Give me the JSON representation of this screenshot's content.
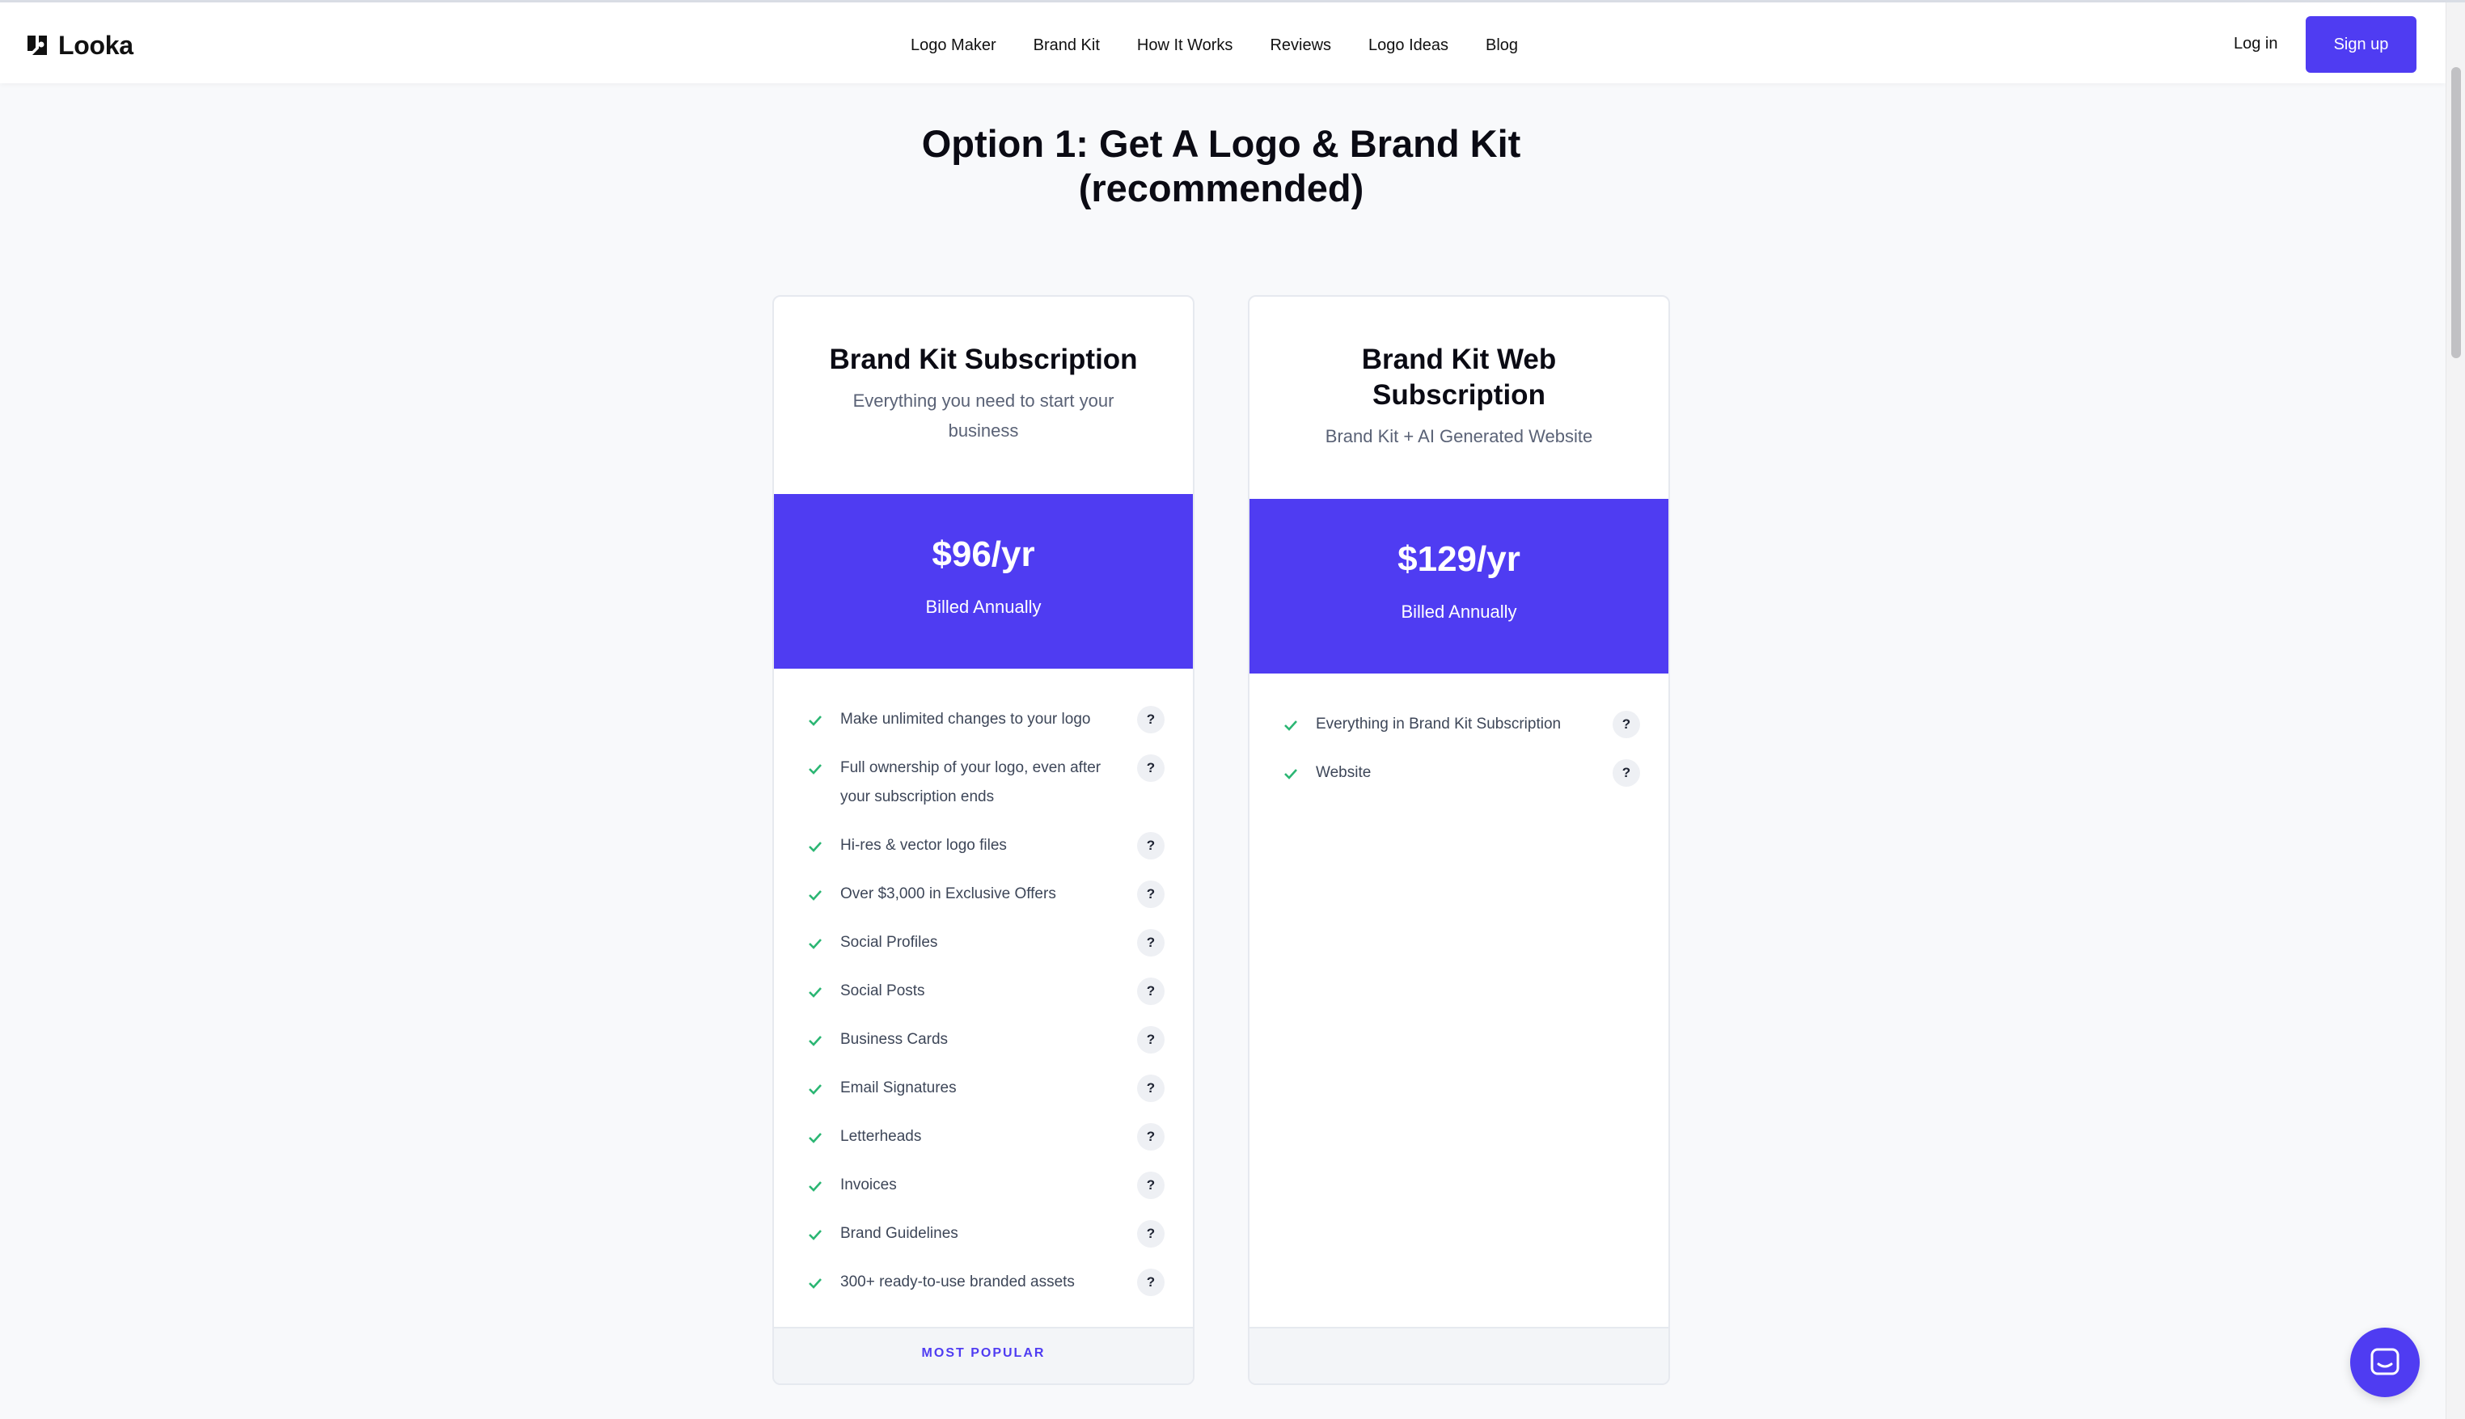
{
  "brand": {
    "name": "Looka"
  },
  "nav": {
    "items": [
      "Logo Maker",
      "Brand Kit",
      "How It Works",
      "Reviews",
      "Logo Ideas",
      "Blog"
    ]
  },
  "auth": {
    "login": "Log in",
    "signup": "Sign up"
  },
  "page": {
    "title_line1": "Option 1: Get A Logo & Brand Kit",
    "title_line2": "(recommended)"
  },
  "plans": [
    {
      "title": "Brand Kit Subscription",
      "subtitle": "Everything you need to start your business",
      "price": "$96/yr",
      "billing": "Billed Annually",
      "features": [
        "Make unlimited changes to your logo",
        "Full ownership of your logo, even after your subscription ends",
        "Hi-res & vector logo files",
        "Over $3,000 in Exclusive Offers",
        "Social Profiles",
        "Social Posts",
        "Business Cards",
        "Email Signatures",
        "Letterheads",
        "Invoices",
        "Brand Guidelines",
        "300+ ready-to-use branded assets"
      ],
      "badge": "MOST POPULAR"
    },
    {
      "title_line1": "Brand Kit Web",
      "title_line2": "Subscription",
      "subtitle": "Brand Kit + AI Generated Website",
      "price": "$129/yr",
      "billing": "Billed Annually",
      "features": [
        "Everything in Brand Kit Subscription",
        "Website"
      ],
      "badge": ""
    }
  ],
  "help_glyph": "?",
  "colors": {
    "accent": "#4f3cf2",
    "check": "#2bb673"
  },
  "icons": {
    "chat": "chat-icon",
    "check": "check-icon",
    "help": "question-icon"
  }
}
